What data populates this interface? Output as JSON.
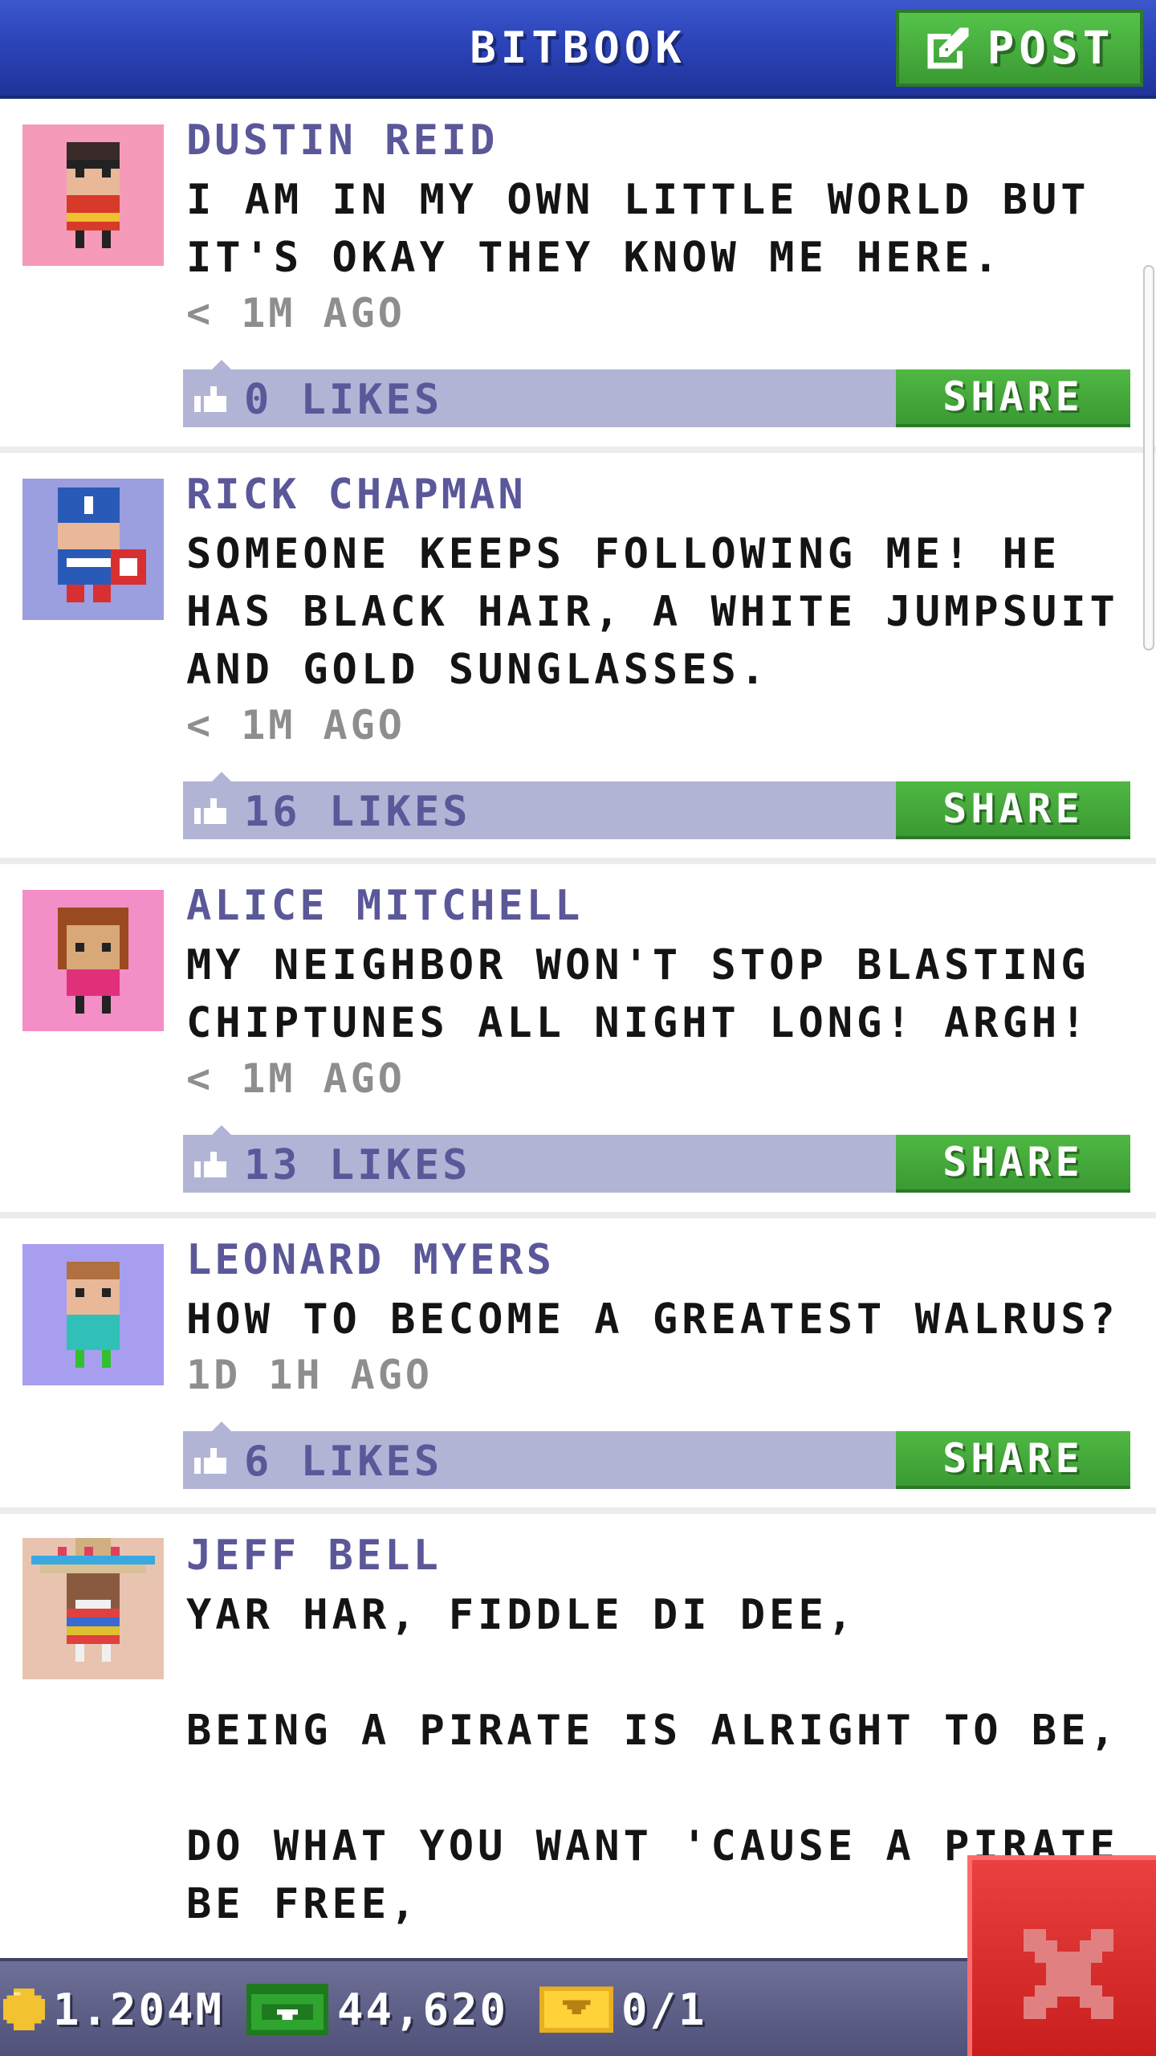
{
  "header": {
    "title": "BITBOOK",
    "post_label": "POST"
  },
  "posts": [
    {
      "author": "DUSTIN REID",
      "text": "I AM IN MY OWN LITTLE WORLD BUT IT'S OKAY THEY KNOW ME HERE.",
      "time": "< 1M AGO",
      "likes": "0 LIKES",
      "share_label": "SHARE",
      "avatar_bg": "#f59ab8"
    },
    {
      "author": "RICK CHAPMAN",
      "text": "SOMEONE KEEPS FOLLOWING ME! HE HAS BLACK HAIR, A WHITE JUMPSUIT AND GOLD SUNGLASSES.",
      "time": "< 1M AGO",
      "likes": "16 LIKES",
      "share_label": "SHARE",
      "avatar_bg": "#9b9edf"
    },
    {
      "author": "ALICE MITCHELL",
      "text": "MY NEIGHBOR WON'T STOP BLASTING CHIPTUNES ALL NIGHT LONG! ARGH!",
      "time": "< 1M AGO",
      "likes": "13 LIKES",
      "share_label": "SHARE",
      "avatar_bg": "#f48ec6"
    },
    {
      "author": "LEONARD MYERS",
      "text": "HOW TO BECOME A GREATEST WALRUS?",
      "time": "1D 1H AGO",
      "likes": "6 LIKES",
      "share_label": "SHARE",
      "avatar_bg": "#a89ef0"
    },
    {
      "author": "JEFF BELL",
      "text": "YAR HAR, FIDDLE DI DEE,\n\nBEING A PIRATE IS ALRIGHT TO BE,\n\nDO WHAT YOU WANT 'CAUSE A PIRATE BE FREE,",
      "avatar_bg": "#e8c4b0"
    }
  ],
  "footer": {
    "coins": "1.204M",
    "bux": "44,620",
    "tickets": "0/1"
  },
  "colors": {
    "header_blue": "#2b44b8",
    "accent_green": "#3a9a33",
    "likes_bar": "#b2b4d6",
    "author_purple": "#5a5899",
    "close_red": "#d42a2a"
  }
}
